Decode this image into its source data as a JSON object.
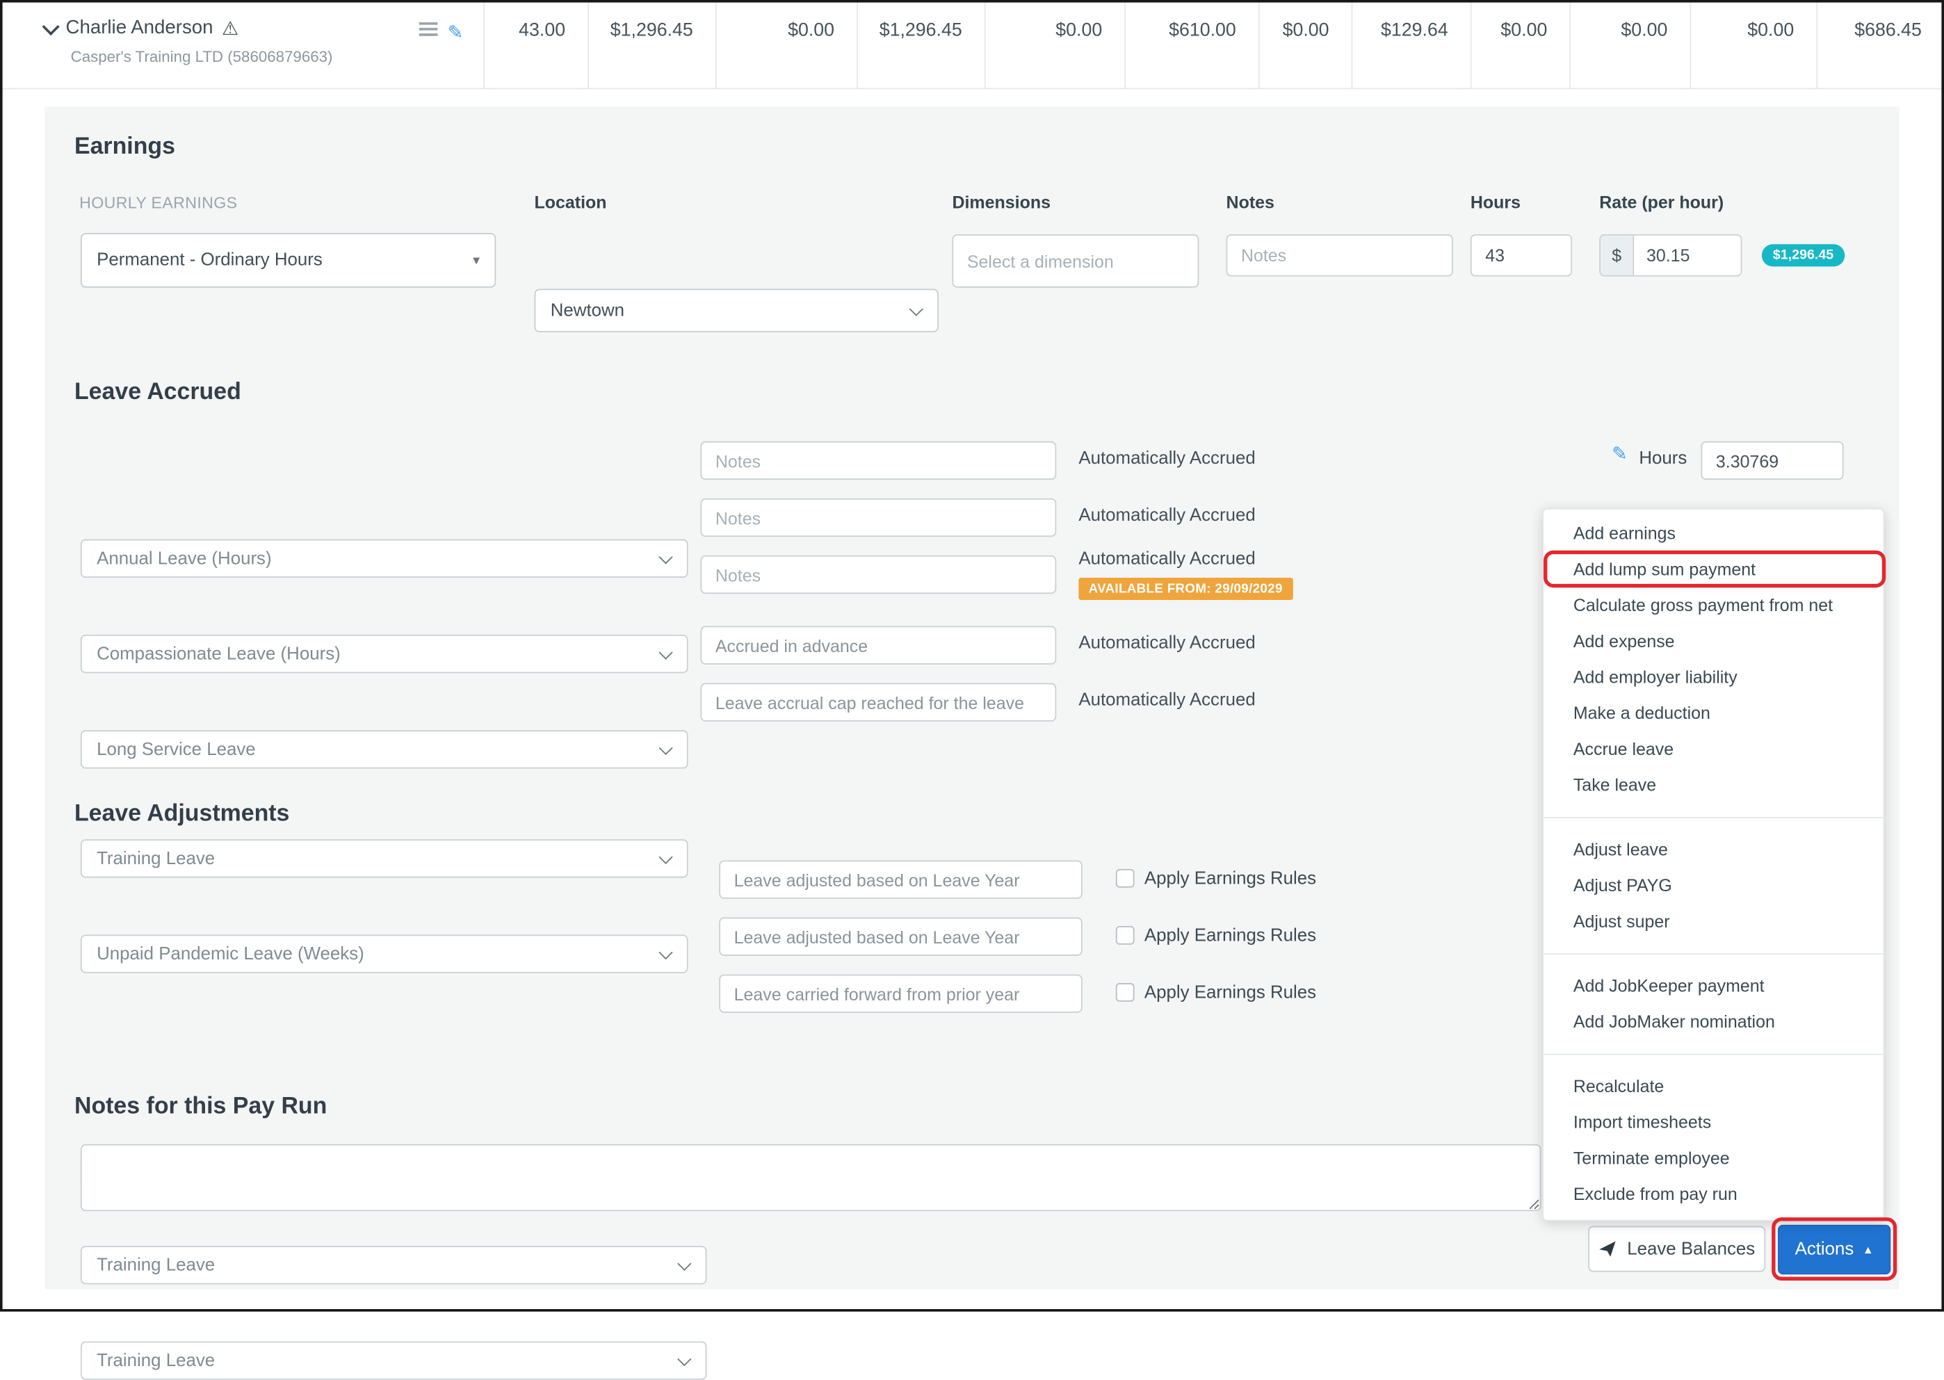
{
  "colors": {
    "accent_blue": "#2173d2",
    "teal_badge": "#17b8c5",
    "warning_orange_badge": "#f0a43c",
    "annotation_red": "#e4272e",
    "pencil_blue": "#3f9ff2"
  },
  "icons": {
    "warning": "⚠",
    "pencil": "✎",
    "caret_up": "▲",
    "caret_down": "▾"
  },
  "header": {
    "employee_name": "Charlie Anderson",
    "company": "Casper's Training LTD (58606879663)",
    "totals": [
      "43.00",
      "$1,296.45",
      "$0.00",
      "$1,296.45",
      "$0.00",
      "$610.00",
      "$0.00",
      "$129.64",
      "$0.00",
      "$0.00",
      "$0.00",
      "$686.45"
    ]
  },
  "earnings": {
    "title": "Earnings",
    "group_label": "HOURLY EARNINGS",
    "pay_category": "Permanent - Ordinary Hours",
    "location_label": "Location",
    "location": "Newtown",
    "dimensions_label": "Dimensions",
    "dimensions_placeholder": "Select a dimension",
    "notes_label": "Notes",
    "notes_placeholder": "Notes",
    "hours_label": "Hours",
    "hours": "43",
    "currency": "$",
    "rate_label": "Rate (per hour)",
    "rate": "30.15",
    "total": "$1,296.45"
  },
  "leave_accrued": {
    "title": "Leave Accrued",
    "rows": [
      {
        "type": "Annual Leave (Hours)",
        "notes_placeholder": "Notes",
        "status": "Automatically Accrued",
        "hours_label": "Hours",
        "hours": "3.30769"
      },
      {
        "type": "Compassionate Leave (Hours)",
        "notes_placeholder": "Notes",
        "status": "Automatically Accrued"
      },
      {
        "type": "Long Service Leave",
        "notes_placeholder": "Notes",
        "status": "Automatically Accrued",
        "badge": "AVAILABLE FROM: 29/09/2029"
      },
      {
        "type": "Training Leave",
        "notes": "Accrued in advance",
        "status": "Automatically Accrued"
      },
      {
        "type": "Unpaid Pandemic Leave (Weeks)",
        "notes": "Leave accrual cap reached for the leave",
        "status": "Automatically Accrued"
      }
    ]
  },
  "leave_adjustments": {
    "title": "Leave Adjustments",
    "apply_label": "Apply Earnings Rules",
    "rows": [
      {
        "type": "Unpaid Pandemic Leave (Weeks)",
        "notes": "Leave adjusted based on Leave Year"
      },
      {
        "type": "Training Leave",
        "notes": "Leave adjusted based on Leave Year"
      },
      {
        "type": "Training Leave",
        "notes": "Leave carried forward from prior year"
      }
    ]
  },
  "pay_run_notes": {
    "title": "Notes for this Pay Run"
  },
  "footer": {
    "leave_balances": "Leave Balances",
    "actions": "Actions"
  },
  "actions_menu": {
    "highlighted_item": "Add lump sum payment",
    "groups": [
      {
        "items": [
          "Add earnings",
          "Add lump sum payment",
          "Calculate gross payment from net",
          "Add expense",
          "Add employer liability",
          "Make a deduction",
          "Accrue leave",
          "Take leave"
        ]
      },
      {
        "items": [
          "Adjust leave",
          "Adjust PAYG",
          "Adjust super"
        ]
      },
      {
        "items": [
          "Add JobKeeper payment",
          "Add JobMaker nomination"
        ]
      },
      {
        "items": [
          "Recalculate",
          "Import timesheets",
          "Terminate employee",
          "Exclude from pay run"
        ]
      }
    ]
  }
}
